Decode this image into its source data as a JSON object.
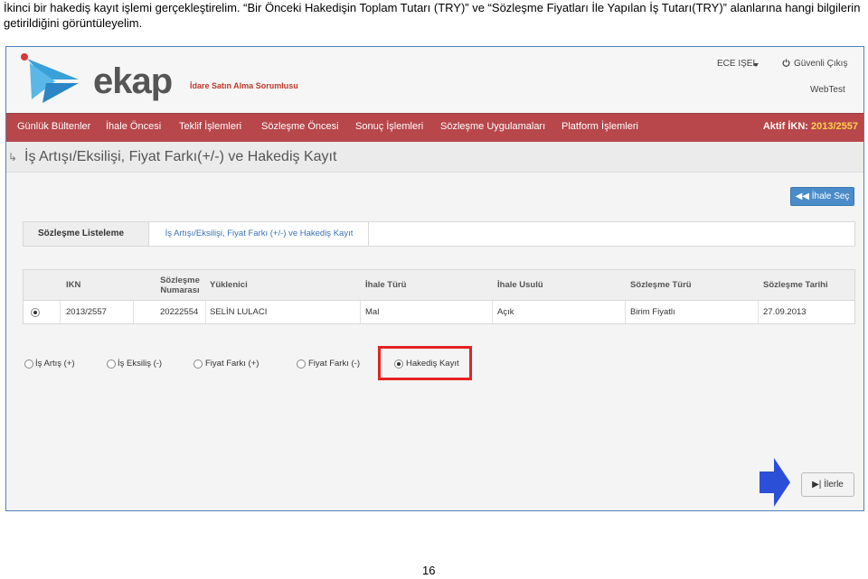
{
  "caption": "İkinci bir hakediş kayıt işlemi gerçekleştirelim. “Bir Önceki Hakedişin Toplam Tutarı (TRY)” ve “Sözleşme Fiyatları İle Yapılan İş Tutarı(TRY)” alanlarına hangi bilgilerin getirildiğini görüntüleyelim.",
  "header": {
    "logo_text": "ekap",
    "logo_subtitle": "İdare Satın Alma Sorumlusu",
    "user_name": "ECE IŞEL",
    "logout_label": "Güvenli Çıkış",
    "environment": "WebTest"
  },
  "nav": {
    "items": [
      "Günlük Bültenler",
      "İhale Öncesi",
      "Teklif İşlemleri",
      "Sözleşme Öncesi",
      "Sonuç İşlemleri",
      "Sözleşme Uygulamaları",
      "Platform İşlemleri"
    ],
    "active_ikn_label": "Aktif İKN:",
    "active_ikn_value": "2013/2557"
  },
  "page": {
    "title": "İş Artışı/Eksilişi, Fiyat Farkı(+/-) ve Hakediş Kayıt",
    "select_tender_button": "İhale Seç"
  },
  "tabs": [
    "Sözleşme Listeleme",
    "İş Artışı/Eksilişi, Fiyat Farkı (+/-) ve Hakediş Kayıt"
  ],
  "grid": {
    "columns": [
      "IKN",
      "Sözleşme Numarası",
      "Yüklenici",
      "İhale Türü",
      "İhale Usulü",
      "Sözleşme Türü",
      "Sözleşme Tarihi"
    ],
    "rows": [
      {
        "ikn": "2013/2557",
        "contract_no": "20222554",
        "contractor": "SELİN LULACI",
        "tender_type": "Mal",
        "tender_method": "Açık",
        "contract_type": "Birim Fiyatlı",
        "contract_date": "27.09.2013",
        "selected": true
      }
    ]
  },
  "options": [
    {
      "label": "İş Artış (+)",
      "selected": false
    },
    {
      "label": "İş Eksiliş (-)",
      "selected": false
    },
    {
      "label": "Fiyat Farkı (+)",
      "selected": false
    },
    {
      "label": "Fiyat Farkı (-)",
      "selected": false
    },
    {
      "label": "Hakediş Kayıt",
      "selected": true
    }
  ],
  "next_button": "İlerle",
  "page_number": "16",
  "colors": {
    "nav_bg": "#b7474b",
    "ikn_highlight": "#ffd24d",
    "button_blue": "#4a8cc9",
    "highlight_red": "#e32322",
    "arrow_blue": "#2b4fd6"
  }
}
